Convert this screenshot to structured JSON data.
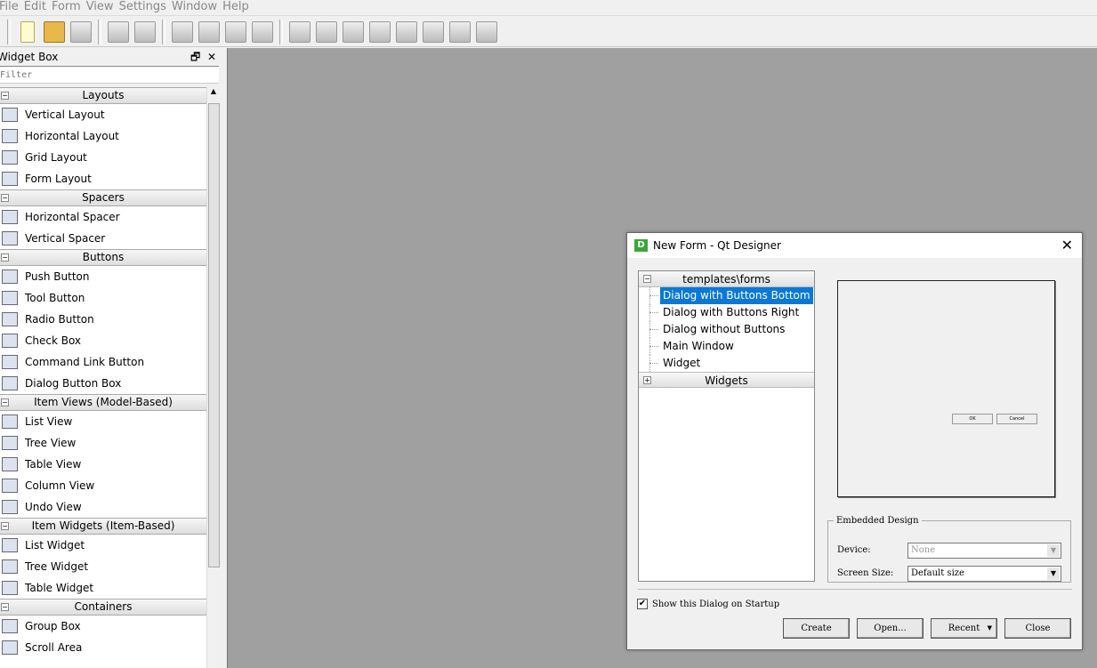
{
  "menu": [
    "File",
    "Edit",
    "Form",
    "View",
    "Settings",
    "Window",
    "Help"
  ],
  "widget_box": {
    "title": "Widget Box",
    "float_glyph": "🗗",
    "close_glyph": "✕",
    "filter_placeholder": "Filter",
    "categories": [
      {
        "label": "Layouts",
        "items": [
          "Vertical Layout",
          "Horizontal Layout",
          "Grid Layout",
          "Form Layout"
        ]
      },
      {
        "label": "Spacers",
        "items": [
          "Horizontal Spacer",
          "Vertical Spacer"
        ]
      },
      {
        "label": "Buttons",
        "items": [
          "Push Button",
          "Tool Button",
          "Radio Button",
          "Check Box",
          "Command Link Button",
          "Dialog Button Box"
        ]
      },
      {
        "label": "Item Views (Model-Based)",
        "items": [
          "List View",
          "Tree View",
          "Table View",
          "Column View",
          "Undo View"
        ]
      },
      {
        "label": "Item Widgets (Item-Based)",
        "items": [
          "List Widget",
          "Tree Widget",
          "Table Widget"
        ]
      },
      {
        "label": "Containers",
        "items": [
          "Group Box",
          "Scroll Area"
        ]
      }
    ]
  },
  "dialog": {
    "icon": "D",
    "title": "New Form - Qt Designer",
    "close": "✕",
    "tree": {
      "root": "templates\\forms",
      "items": [
        "Dialog with Buttons Bottom",
        "Dialog with Buttons Right",
        "Dialog without Buttons",
        "Main Window",
        "Widget"
      ],
      "selected": 0,
      "second_root": "Widgets"
    },
    "preview": {
      "ok": "OK",
      "cancel": "Cancel"
    },
    "embedded": {
      "legend": "Embedded Design",
      "device_label": "Device:",
      "device_value": "None",
      "screen_label": "Screen Size:",
      "screen_value": "Default size"
    },
    "show_on_startup": "Show this Dialog on Startup",
    "buttons": {
      "create": "Create",
      "open": "Open...",
      "recent": "Recent",
      "close": "Close"
    }
  },
  "colors": {
    "selection": "#0a78d7",
    "canvas": "#a0a0a0"
  }
}
